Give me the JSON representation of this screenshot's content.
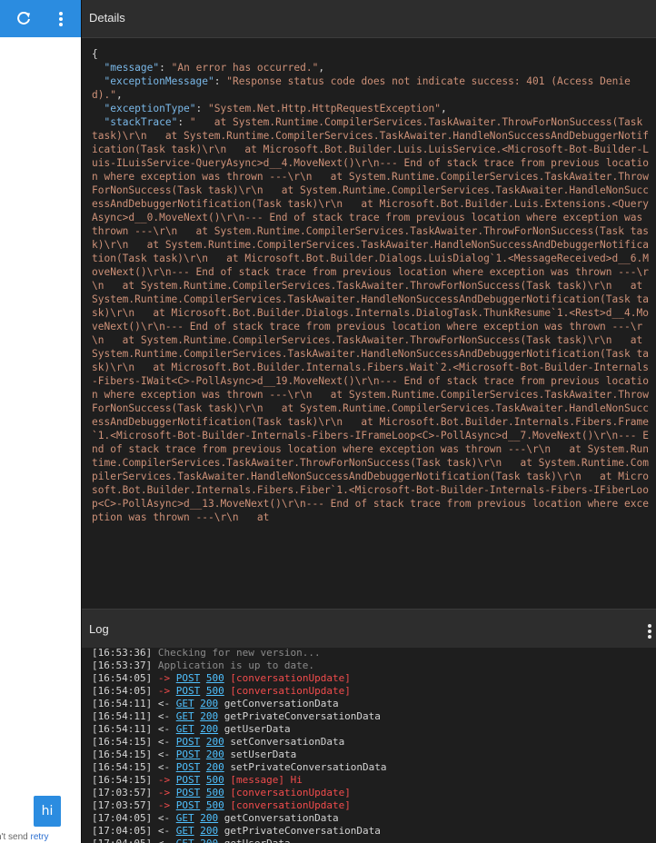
{
  "left_panel": {
    "chat_bubble_text": "hi",
    "send_status_prefix": "n't send",
    "retry_label": "retry"
  },
  "details": {
    "title": "Details",
    "json": {
      "message_key": "message",
      "message_value": "An error has occurred.",
      "exceptionMessage_key": "exceptionMessage",
      "exceptionMessage_value": "Response status code does not indicate success: 401 (Access Denied).",
      "exceptionType_key": "exceptionType",
      "exceptionType_value": "System.Net.Http.HttpRequestException",
      "stackTrace_key": "stackTrace",
      "stackTrace_value": "   at System.Runtime.CompilerServices.TaskAwaiter.ThrowForNonSuccess(Task task)\\r\\n   at System.Runtime.CompilerServices.TaskAwaiter.HandleNonSuccessAndDebuggerNotification(Task task)\\r\\n   at Microsoft.Bot.Builder.Luis.LuisService.<Microsoft-Bot-Builder-Luis-ILuisService-QueryAsync>d__4.MoveNext()\\r\\n--- End of stack trace from previous location where exception was thrown ---\\r\\n   at System.Runtime.CompilerServices.TaskAwaiter.ThrowForNonSuccess(Task task)\\r\\n   at System.Runtime.CompilerServices.TaskAwaiter.HandleNonSuccessAndDebuggerNotification(Task task)\\r\\n   at Microsoft.Bot.Builder.Luis.Extensions.<QueryAsync>d__0.MoveNext()\\r\\n--- End of stack trace from previous location where exception was thrown ---\\r\\n   at System.Runtime.CompilerServices.TaskAwaiter.ThrowForNonSuccess(Task task)\\r\\n   at System.Runtime.CompilerServices.TaskAwaiter.HandleNonSuccessAndDebuggerNotification(Task task)\\r\\n   at Microsoft.Bot.Builder.Dialogs.LuisDialog`1.<MessageReceived>d__6.MoveNext()\\r\\n--- End of stack trace from previous location where exception was thrown ---\\r\\n   at System.Runtime.CompilerServices.TaskAwaiter.ThrowForNonSuccess(Task task)\\r\\n   at System.Runtime.CompilerServices.TaskAwaiter.HandleNonSuccessAndDebuggerNotification(Task task)\\r\\n   at Microsoft.Bot.Builder.Dialogs.Internals.DialogTask.ThunkResume`1.<Rest>d__4.MoveNext()\\r\\n--- End of stack trace from previous location where exception was thrown ---\\r\\n   at System.Runtime.CompilerServices.TaskAwaiter.ThrowForNonSuccess(Task task)\\r\\n   at System.Runtime.CompilerServices.TaskAwaiter.HandleNonSuccessAndDebuggerNotification(Task task)\\r\\n   at Microsoft.Bot.Builder.Internals.Fibers.Wait`2.<Microsoft-Bot-Builder-Internals-Fibers-IWait<C>-PollAsync>d__19.MoveNext()\\r\\n--- End of stack trace from previous location where exception was thrown ---\\r\\n   at System.Runtime.CompilerServices.TaskAwaiter.ThrowForNonSuccess(Task task)\\r\\n   at System.Runtime.CompilerServices.TaskAwaiter.HandleNonSuccessAndDebuggerNotification(Task task)\\r\\n   at Microsoft.Bot.Builder.Internals.Fibers.Frame`1.<Microsoft-Bot-Builder-Internals-Fibers-IFrameLoop<C>-PollAsync>d__7.MoveNext()\\r\\n--- End of stack trace from previous location where exception was thrown ---\\r\\n   at System.Runtime.CompilerServices.TaskAwaiter.ThrowForNonSuccess(Task task)\\r\\n   at System.Runtime.CompilerServices.TaskAwaiter.HandleNonSuccessAndDebuggerNotification(Task task)\\r\\n   at Microsoft.Bot.Builder.Internals.Fibers.Fiber`1.<Microsoft-Bot-Builder-Internals-Fibers-IFiberLoop<C>-PollAsync>d__13.MoveNext()\\r\\n--- End of stack trace from previous location where exception was thrown ---\\r\\n   at"
    }
  },
  "log": {
    "title": "Log",
    "entries": [
      {
        "time": "[16:53:36]",
        "kind": "info",
        "text": "Checking for new version..."
      },
      {
        "time": "[16:53:37]",
        "kind": "info",
        "text": "Application is up to date."
      },
      {
        "time": "[16:54:05]",
        "kind": "req",
        "dir": "->",
        "verb": "POST",
        "code": "500",
        "text": "[conversationUpdate]",
        "error": true
      },
      {
        "time": "[16:54:05]",
        "kind": "req",
        "dir": "->",
        "verb": "POST",
        "code": "500",
        "text": "[conversationUpdate]",
        "error": true
      },
      {
        "time": "[16:54:11]",
        "kind": "req",
        "dir": "<-",
        "verb": "GET",
        "code": "200",
        "text": "getConversationData",
        "error": false
      },
      {
        "time": "[16:54:11]",
        "kind": "req",
        "dir": "<-",
        "verb": "GET",
        "code": "200",
        "text": "getPrivateConversationData",
        "error": false
      },
      {
        "time": "[16:54:11]",
        "kind": "req",
        "dir": "<-",
        "verb": "GET",
        "code": "200",
        "text": "getUserData",
        "error": false
      },
      {
        "time": "[16:54:15]",
        "kind": "req",
        "dir": "<-",
        "verb": "POST",
        "code": "200",
        "text": "setConversationData",
        "error": false
      },
      {
        "time": "[16:54:15]",
        "kind": "req",
        "dir": "<-",
        "verb": "POST",
        "code": "200",
        "text": "setUserData",
        "error": false
      },
      {
        "time": "[16:54:15]",
        "kind": "req",
        "dir": "<-",
        "verb": "POST",
        "code": "200",
        "text": "setPrivateConversationData",
        "error": false
      },
      {
        "time": "[16:54:15]",
        "kind": "req",
        "dir": "->",
        "verb": "POST",
        "code": "500",
        "text": "[message] Hi",
        "error": true
      },
      {
        "time": "[17:03:57]",
        "kind": "req",
        "dir": "->",
        "verb": "POST",
        "code": "500",
        "text": "[conversationUpdate]",
        "error": true
      },
      {
        "time": "[17:03:57]",
        "kind": "req",
        "dir": "->",
        "verb": "POST",
        "code": "500",
        "text": "[conversationUpdate]",
        "error": true
      },
      {
        "time": "[17:04:05]",
        "kind": "req",
        "dir": "<-",
        "verb": "GET",
        "code": "200",
        "text": "getConversationData",
        "error": false
      },
      {
        "time": "[17:04:05]",
        "kind": "req",
        "dir": "<-",
        "verb": "GET",
        "code": "200",
        "text": "getPrivateConversationData",
        "error": false
      },
      {
        "time": "[17:04:05]",
        "kind": "req",
        "dir": "<-",
        "verb": "GET",
        "code": "200",
        "text": "getUserData",
        "error": false
      }
    ]
  },
  "icons": {
    "refresh": "refresh-icon",
    "more": "more-vertical-icon",
    "log_more": "more-vertical-icon"
  },
  "colors": {
    "accent": "#2b8ce0",
    "error": "#f14c4c",
    "link": "#4fc1ff",
    "json_key": "#7ab8e8",
    "json_string": "#ce9178"
  }
}
